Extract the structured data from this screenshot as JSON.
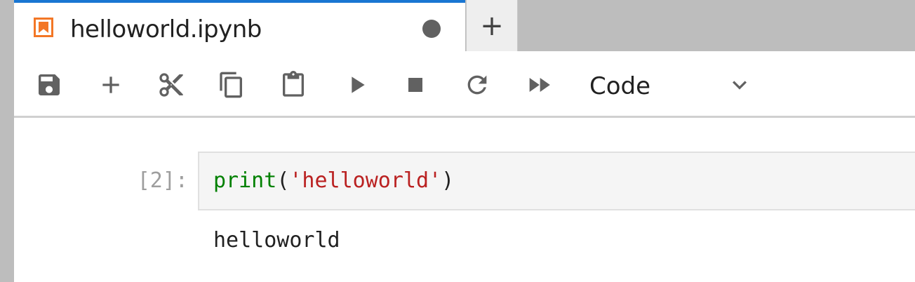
{
  "tabs": {
    "active": {
      "title": "helloworld.ipynb",
      "icon": "notebook-icon",
      "unsaved": true
    },
    "add_label": "+"
  },
  "toolbar": {
    "buttons": [
      {
        "name": "save-button",
        "icon": "save-icon"
      },
      {
        "name": "insert-cell-button",
        "icon": "add-icon"
      },
      {
        "name": "cut-button",
        "icon": "cut-icon"
      },
      {
        "name": "copy-button",
        "icon": "copy-icon"
      },
      {
        "name": "paste-button",
        "icon": "paste-icon"
      },
      {
        "name": "run-button",
        "icon": "run-icon"
      },
      {
        "name": "interrupt-button",
        "icon": "stop-icon"
      },
      {
        "name": "restart-button",
        "icon": "refresh-icon"
      },
      {
        "name": "run-all-button",
        "icon": "fast-forward-icon"
      }
    ],
    "cell_type": "Code"
  },
  "cell": {
    "prompt": "[2]:",
    "code": {
      "builtin": "print",
      "open_paren": "(",
      "string": "'helloworld'",
      "close_paren": ")"
    },
    "output": "helloworld"
  },
  "colors": {
    "accent": "#1976d2",
    "notebook_icon": "#f37726",
    "code_builtin": "#008000",
    "code_string": "#ba2121"
  }
}
